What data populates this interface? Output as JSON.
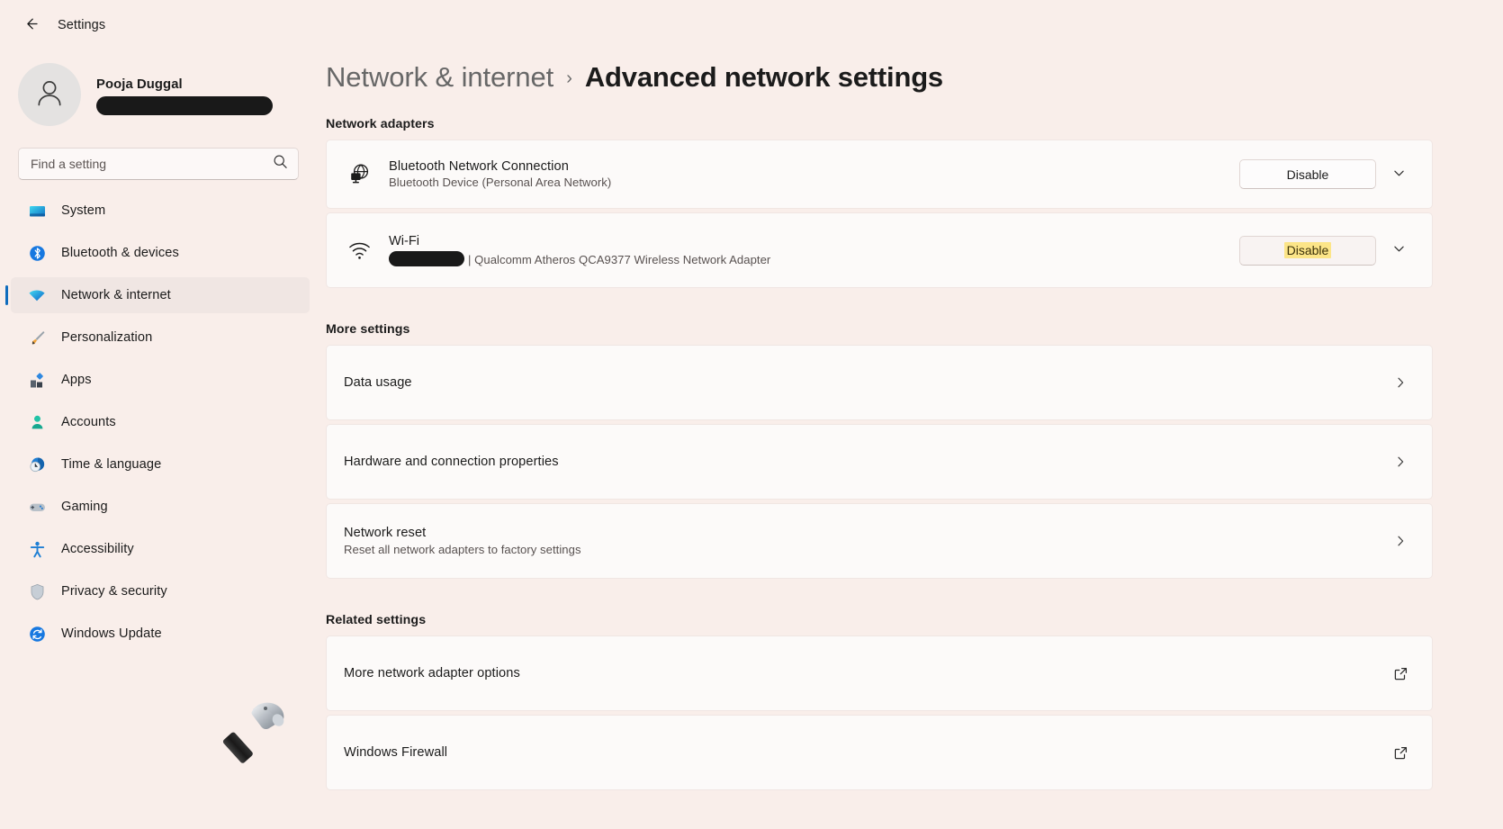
{
  "window": {
    "back_label": "Back",
    "title": "Settings",
    "back_icon": "arrow-left-icon"
  },
  "account": {
    "name": "Pooja Duggal",
    "email_redacted": true,
    "avatar_icon": "person-avatar-icon"
  },
  "search": {
    "placeholder": "Find a setting",
    "value": "",
    "icon": "search-icon"
  },
  "sidebar": {
    "items": [
      {
        "label": "System",
        "icon": "monitor-icon",
        "selected": false
      },
      {
        "label": "Bluetooth & devices",
        "icon": "bluetooth-icon",
        "selected": false
      },
      {
        "label": "Network & internet",
        "icon": "wifi-icon",
        "selected": true
      },
      {
        "label": "Personalization",
        "icon": "paintbrush-icon",
        "selected": false
      },
      {
        "label": "Apps",
        "icon": "apps-icon",
        "selected": false
      },
      {
        "label": "Accounts",
        "icon": "person-icon",
        "selected": false
      },
      {
        "label": "Time & language",
        "icon": "clock-globe-icon",
        "selected": false
      },
      {
        "label": "Gaming",
        "icon": "gamepad-icon",
        "selected": false
      },
      {
        "label": "Accessibility",
        "icon": "accessibility-icon",
        "selected": false
      },
      {
        "label": "Privacy & security",
        "icon": "shield-icon",
        "selected": false
      },
      {
        "label": "Windows Update",
        "icon": "refresh-icon",
        "selected": false
      }
    ],
    "decoration_icon": "hammer-icon"
  },
  "header": {
    "breadcrumb_parent": "Network & internet",
    "breadcrumb_separator": "›",
    "breadcrumb_current": "Advanced network settings"
  },
  "sections": {
    "network_adapters": {
      "title": "Network adapters",
      "adapters": [
        {
          "icon": "bluetooth-network-icon",
          "name": "Bluetooth Network Connection",
          "description": "Bluetooth Device (Personal Area Network)",
          "ssid_redacted": false,
          "action_label": "Disable",
          "action_highlighted": false,
          "expander_icon": "chevron-down-icon"
        },
        {
          "icon": "wifi-signal-icon",
          "name": "Wi-Fi",
          "description": "| Qualcomm Atheros QCA9377 Wireless Network Adapter",
          "ssid_redacted": true,
          "action_label": "Disable",
          "action_highlighted": true,
          "expander_icon": "chevron-down-icon"
        }
      ]
    },
    "more_settings": {
      "title": "More settings",
      "rows": [
        {
          "title": "Data usage",
          "subtitle": "",
          "affordance": "chevron-right-icon"
        },
        {
          "title": "Hardware and connection properties",
          "subtitle": "",
          "affordance": "chevron-right-icon"
        },
        {
          "title": "Network reset",
          "subtitle": "Reset all network adapters to factory settings",
          "affordance": "chevron-right-icon"
        }
      ]
    },
    "related_settings": {
      "title": "Related settings",
      "rows": [
        {
          "title": "More network adapter options",
          "subtitle": "",
          "affordance": "external-link-icon"
        },
        {
          "title": "Windows Firewall",
          "subtitle": "",
          "affordance": "external-link-icon"
        }
      ]
    }
  },
  "colors": {
    "page_background": "#f9eeea",
    "card_background": "#fcfaf9",
    "accent": "#0f6cbd",
    "highlight": "#fce588",
    "selected_nav": "#f0e6e3"
  }
}
